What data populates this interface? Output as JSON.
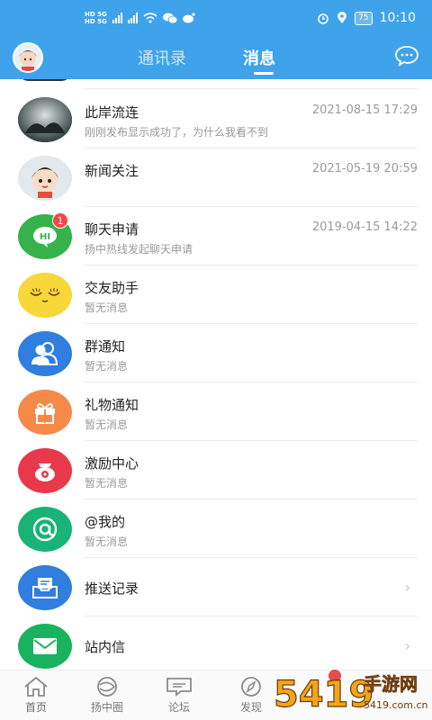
{
  "status_bar": {
    "sim1": "HD 5G",
    "sim2": "HD 5G",
    "battery": "75",
    "time": "10:10",
    "icons": [
      "signal-icon",
      "wifi-icon",
      "wechat-icon",
      "weibo-icon",
      "alarm-icon",
      "location-icon"
    ]
  },
  "header": {
    "tabs": [
      {
        "label": "通讯录",
        "active": false
      },
      {
        "label": "消息",
        "active": true
      }
    ],
    "accent": "#3ea3ea"
  },
  "messages": [
    {
      "name": "此岸流连",
      "preview": "刚刚发布显示成功了，为什么我看不到",
      "time": "2021-08-15 17:29",
      "icon": "photo-avatar"
    },
    {
      "name": "新闻关注",
      "preview": "",
      "time": "2021-05-19 20:59",
      "icon": "cartoon-girl-avatar"
    },
    {
      "name": "聊天申请",
      "preview": "扬中热线发起聊天申请",
      "time": "2019-04-15 14:22",
      "icon": "hi-chat-icon",
      "badge": "1"
    },
    {
      "name": "交友助手",
      "preview": "暂无消息",
      "time": "",
      "icon": "sleepy-face-icon"
    },
    {
      "name": "群通知",
      "preview": "暂无消息",
      "time": "",
      "icon": "group-icon"
    },
    {
      "name": "礼物通知",
      "preview": "暂无消息",
      "time": "",
      "icon": "gift-icon"
    },
    {
      "name": "激励中心",
      "preview": "暂无消息",
      "time": "",
      "icon": "reward-bag-icon"
    },
    {
      "name": "@我的",
      "preview": "暂无消息",
      "time": "",
      "icon": "at-icon"
    },
    {
      "name": "推送记录",
      "preview": "",
      "time": "",
      "icon": "inbox-icon"
    },
    {
      "name": "站内信",
      "preview": "",
      "time": "",
      "icon": "mail-icon"
    }
  ],
  "bottom_nav": [
    {
      "label": "首页",
      "icon": "home-icon"
    },
    {
      "label": "扬中圈",
      "icon": "circle-icon"
    },
    {
      "label": "论坛",
      "icon": "forum-icon"
    },
    {
      "label": "发现",
      "icon": "compass-icon"
    }
  ],
  "watermark": {
    "text": "5419手游网",
    "sub": "5419.com.cn"
  }
}
